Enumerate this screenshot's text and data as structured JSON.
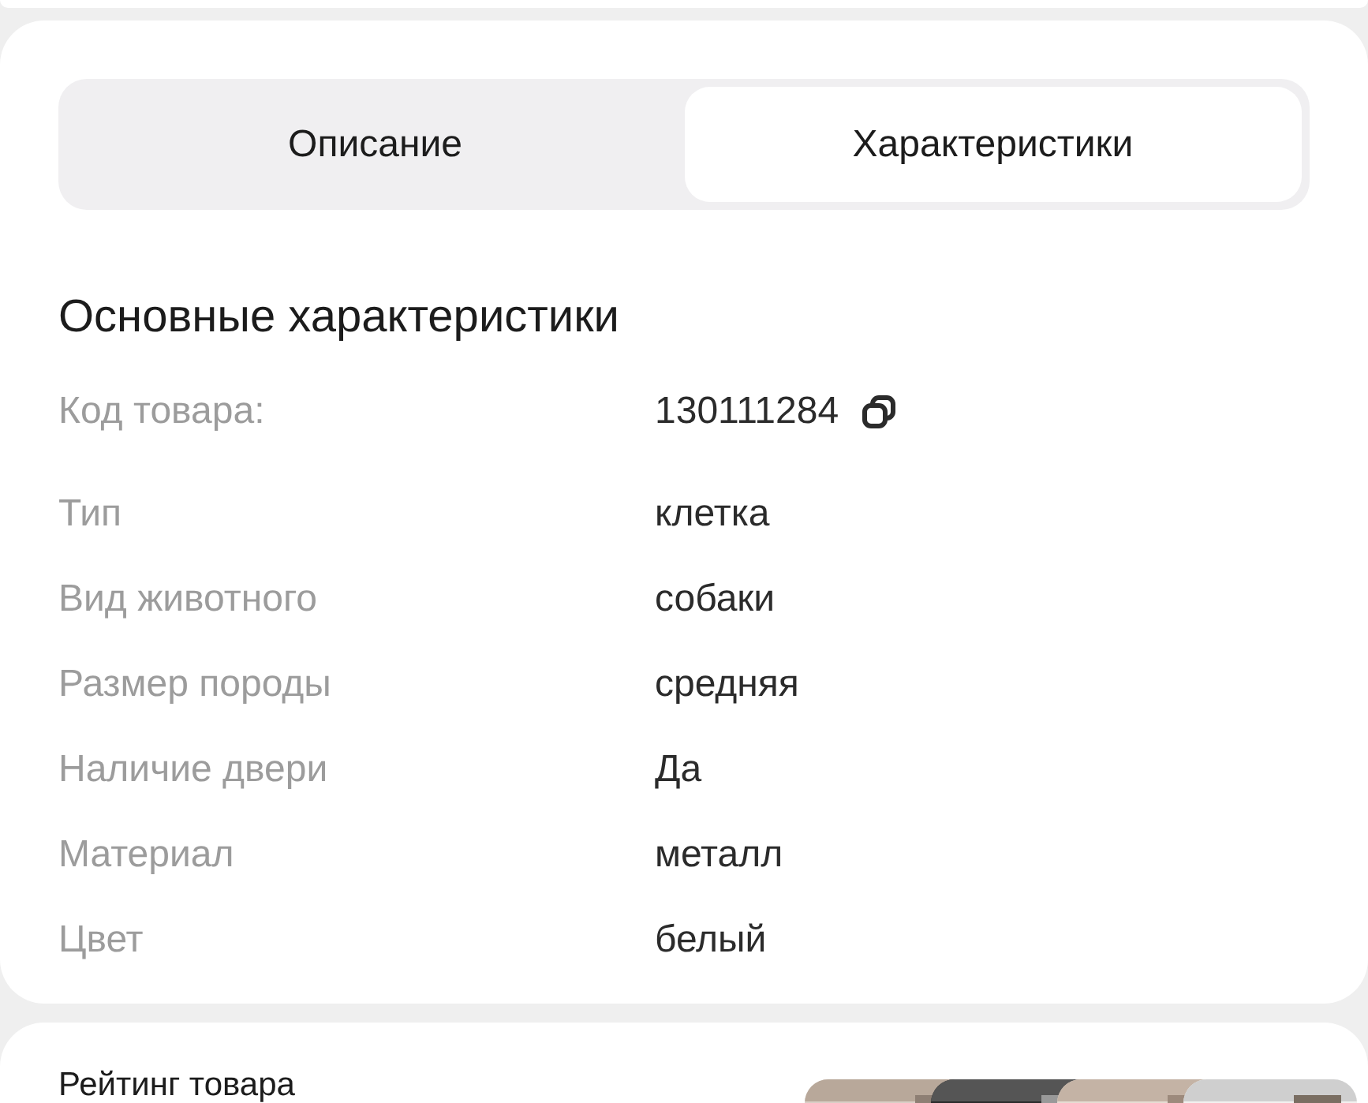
{
  "tabs": [
    {
      "label": "Описание",
      "selected": false
    },
    {
      "label": "Характеристики",
      "selected": true
    }
  ],
  "section_title": "Основные характеристики",
  "specs": [
    {
      "label": "Код товара:",
      "value": "130111284",
      "copyable": true
    },
    {
      "label": "Тип",
      "value": "клетка",
      "copyable": false
    },
    {
      "label": "Вид животного",
      "value": "собаки",
      "copyable": false
    },
    {
      "label": "Размер породы",
      "value": "средняя",
      "copyable": false
    },
    {
      "label": "Наличие двери",
      "value": "Да",
      "copyable": false
    },
    {
      "label": "Материал",
      "value": "металл",
      "copyable": false
    },
    {
      "label": "Цвет",
      "value": "белый",
      "copyable": false
    }
  ],
  "rating_card": {
    "title": "Рейтинг товара"
  }
}
